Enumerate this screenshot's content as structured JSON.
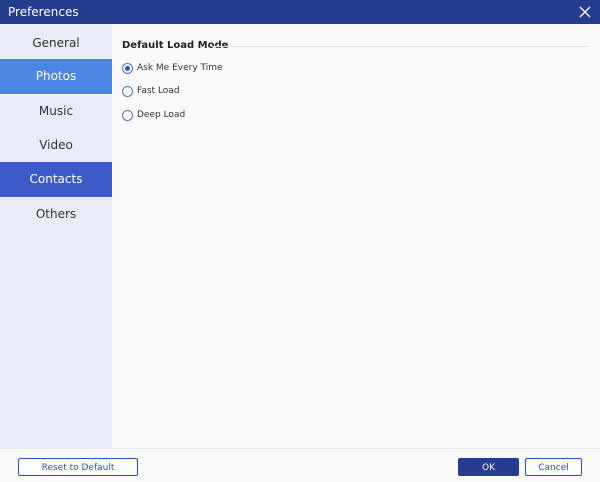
{
  "window": {
    "title": "Preferences",
    "close_icon": "close-icon"
  },
  "sidebar": {
    "items": [
      {
        "label": "General"
      },
      {
        "label": "Photos"
      },
      {
        "label": "Music"
      },
      {
        "label": "Video"
      },
      {
        "label": "Contacts"
      },
      {
        "label": "Others"
      }
    ]
  },
  "main": {
    "section_title": "Default Load Mode",
    "options": [
      {
        "label": "Ask Me Every Time",
        "checked": true
      },
      {
        "label": "Fast Load",
        "checked": false
      },
      {
        "label": "Deep Load",
        "checked": false
      }
    ]
  },
  "footer": {
    "reset_label": "Reset to Default",
    "ok_label": "OK",
    "cancel_label": "Cancel"
  },
  "colors": {
    "titlebar": "#253d8e",
    "sidebar_bg": "#e9ecf7",
    "highlight_light": "#4d85e4",
    "highlight_dark": "#3c5bc9"
  }
}
